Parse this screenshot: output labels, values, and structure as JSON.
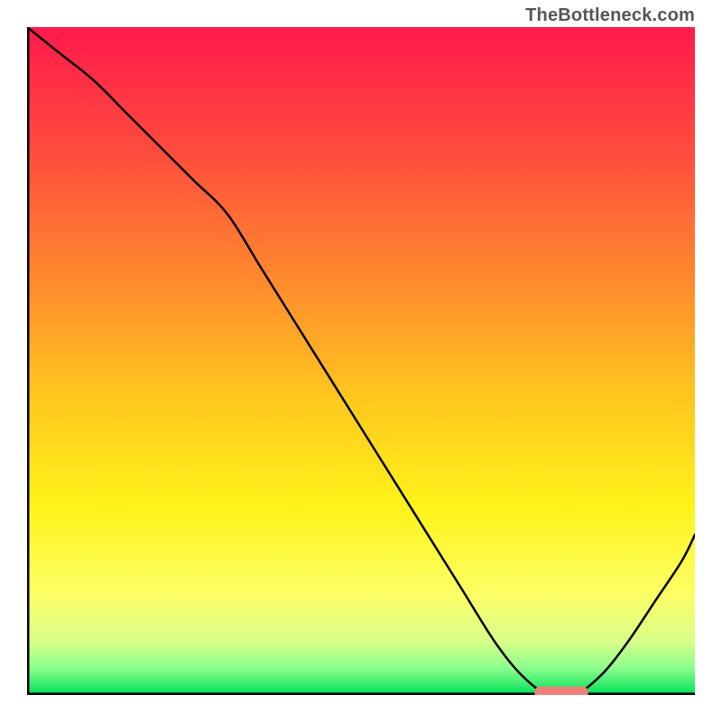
{
  "attribution": "TheBottleneck.com",
  "chart_data": {
    "type": "line",
    "title": "",
    "xlabel": "",
    "ylabel": "",
    "xlim": [
      0,
      100
    ],
    "ylim": [
      0,
      100
    ],
    "grid": false,
    "legend": false,
    "background_gradient": {
      "stops": [
        {
          "offset": 0.0,
          "color": "#ff1a4b"
        },
        {
          "offset": 0.18,
          "color": "#ff4a3e"
        },
        {
          "offset": 0.38,
          "color": "#ff8a2d"
        },
        {
          "offset": 0.55,
          "color": "#ffc61e"
        },
        {
          "offset": 0.72,
          "color": "#fff31a"
        },
        {
          "offset": 0.85,
          "color": "#fcff66"
        },
        {
          "offset": 0.92,
          "color": "#d8ff8a"
        },
        {
          "offset": 0.96,
          "color": "#8bff8b"
        },
        {
          "offset": 1.0,
          "color": "#00e05a"
        }
      ]
    },
    "series": [
      {
        "name": "bottleneck-curve",
        "color": "#000000",
        "width": 2.5,
        "x": [
          0,
          5,
          10,
          15,
          20,
          25,
          30,
          35,
          40,
          45,
          50,
          55,
          60,
          65,
          70,
          74,
          78,
          82,
          86,
          90,
          94,
          98,
          100
        ],
        "y": [
          100,
          96,
          92,
          87,
          82,
          77,
          72,
          64,
          56,
          48,
          40,
          32,
          24,
          16,
          8,
          3,
          0,
          0,
          3,
          8,
          14,
          20,
          24
        ]
      }
    ],
    "marker": {
      "name": "highlight-segment",
      "shape": "rounded-rect",
      "color": "#ef7f7d",
      "x_center": 80,
      "y_center": 0,
      "width": 8,
      "height": 2
    },
    "axes": {
      "x": {
        "visible": true,
        "color": "#000000",
        "width": 5
      },
      "y": {
        "visible": true,
        "color": "#000000",
        "width": 5
      }
    }
  }
}
